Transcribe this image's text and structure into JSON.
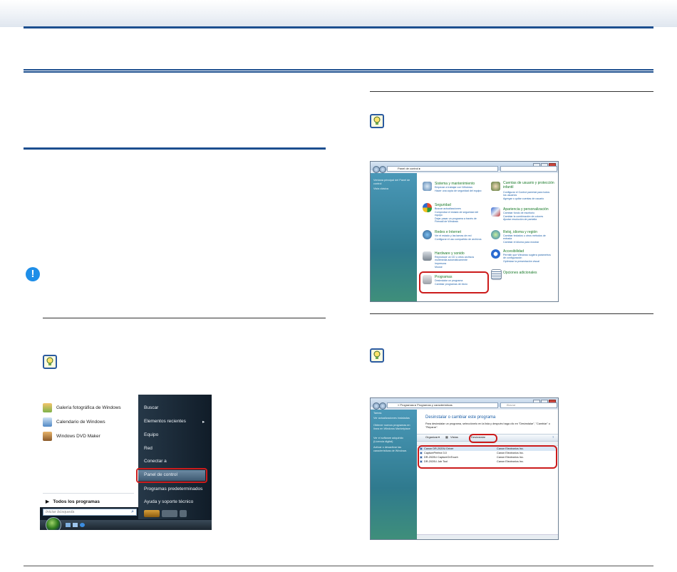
{
  "start_menu": {
    "left_items": [
      "Galería fotográfica de Windows",
      "Calendario de Windows",
      "Windows DVD Maker"
    ],
    "all_programs": "Todos los programas",
    "search_placeholder": "Iniciar búsqueda",
    "right_items": [
      "Buscar",
      "Elementos recientes",
      "Equipo",
      "Red",
      "Conectar a",
      "Panel de control",
      "Programas predeterminados",
      "Ayuda y soporte técnico"
    ]
  },
  "control_panel": {
    "address": "Panel de control",
    "sidebar": [
      "Ventana principal del Panel de control",
      "Vista clásica"
    ],
    "categories": [
      {
        "title": "Sistema y mantenimiento",
        "links": [
          "Empezar a trabajar con Windows",
          "Hacer una copia de seguridad del equipo"
        ]
      },
      {
        "title": "Cuentas de usuario y protección infantil",
        "links": [
          "Configurar el Control parental para todos los usuarios",
          "Agregar o quitar cuentas de usuario"
        ]
      },
      {
        "title": "Seguridad",
        "links": [
          "Buscar actualizaciones",
          "Comprobar el estado de seguridad del equipo",
          "Dejar pasar un programa a través de Firewall de Windows"
        ]
      },
      {
        "title": "Apariencia y personalización",
        "links": [
          "Cambiar fondo de escritorio",
          "Cambiar la combinación de colores",
          "Ajustar resolución de pantalla"
        ]
      },
      {
        "title": "Redes e Internet",
        "links": [
          "Ver el estado y las tareas de red",
          "Configurar el uso compartido de archivos"
        ]
      },
      {
        "title": "Reloj, idioma y región",
        "links": [
          "Cambiar teclados u otros métodos de entrada",
          "Cambiar el idioma para mostrar"
        ]
      },
      {
        "title": "Hardware y sonido",
        "links": [
          "Reproducir un CD u otros archivos multimedia automáticamente",
          "Impresora",
          "Mouse"
        ]
      },
      {
        "title": "Accesibilidad",
        "links": [
          "Permitir que Windows sugiera parámetros de configuración",
          "Optimizar la presentación visual"
        ]
      },
      {
        "title": "Opciones adicionales",
        "links": []
      },
      {
        "title": "Programas",
        "links": [
          "Desinstalar un programa",
          "Cambiar programas de inicio"
        ]
      }
    ]
  },
  "programs_window": {
    "address": "« Programas ▸ Programas y características",
    "search_placeholder": "Buscar",
    "sidebar": [
      "Tareas",
      "Ver actualizaciones instaladas",
      "Obtener nuevos programas en línea en Windows Marketplace",
      "Ver el software adquirido (Licencia digital)",
      "Activar o desactivar las características de Windows"
    ],
    "heading": "Desinstalar o cambiar este programa",
    "description": "Para desinstalar un programa, selecciónelo en la lista y después haga clic en \"Desinstalar\", \"Cambiar\" o \"Reparar\".",
    "toolbar": [
      "Organizar",
      "Vistas",
      "Desinstalar"
    ],
    "rows": [
      {
        "name": "Canon DR-2020U Driver",
        "publisher": "Canon Electronics Inc."
      },
      {
        "name": "CapturePerfect 3.0",
        "publisher": "Canon Electronics Inc."
      },
      {
        "name": "DR-2020U CaptureOnTouch",
        "publisher": "Canon Electronics Inc."
      },
      {
        "name": "DR-2020U Job Tool",
        "publisher": "Canon Electronics Inc."
      }
    ]
  }
}
